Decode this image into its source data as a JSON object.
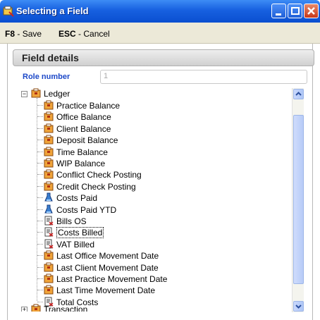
{
  "window": {
    "title": "Selecting a Field",
    "icon": "app-icon",
    "controls": [
      "minimize",
      "maximize",
      "close"
    ]
  },
  "shortcuts": {
    "save_key": "F8",
    "save_label": "- Save",
    "cancel_key": "ESC",
    "cancel_label": "- Cancel"
  },
  "section": {
    "title": "Field details"
  },
  "role": {
    "label": "Role number",
    "value": "1"
  },
  "tree": {
    "root_label": "Ledger",
    "items": [
      {
        "label": "Practice Balance",
        "icon": "folder-icon"
      },
      {
        "label": "Office Balance",
        "icon": "folder-icon"
      },
      {
        "label": "Client Balance",
        "icon": "folder-icon"
      },
      {
        "label": "Deposit Balance",
        "icon": "folder-icon"
      },
      {
        "label": "Time Balance",
        "icon": "folder-icon"
      },
      {
        "label": "WIP Balance",
        "icon": "folder-icon"
      },
      {
        "label": "Conflict Check Posting",
        "icon": "folder-icon"
      },
      {
        "label": "Credit Check Posting",
        "icon": "folder-icon"
      },
      {
        "label": "Costs Paid",
        "icon": "flask-icon"
      },
      {
        "label": "Costs Paid YTD",
        "icon": "flask-icon"
      },
      {
        "label": "Bills OS",
        "icon": "document-icon"
      },
      {
        "label": "Costs Billed",
        "icon": "document-icon",
        "selected": true
      },
      {
        "label": "VAT Billed",
        "icon": "document-icon"
      },
      {
        "label": "Last Office Movement Date",
        "icon": "folder-icon"
      },
      {
        "label": "Last Client Movement Date",
        "icon": "folder-icon"
      },
      {
        "label": "Last Practice Movement Date",
        "icon": "folder-icon"
      },
      {
        "label": "Last Time Movement Date",
        "icon": "folder-icon"
      },
      {
        "label": "Total Costs",
        "icon": "document-icon"
      }
    ],
    "next_root_label": "Transaction"
  }
}
